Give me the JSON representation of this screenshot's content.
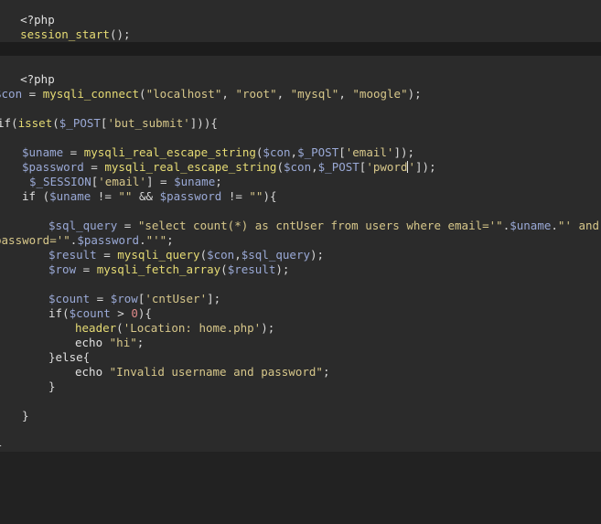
{
  "top_block": {
    "line1": "<?php",
    "line2_fn": "session_start",
    "line2_rest": "();",
    "line3": "?>"
  },
  "main_block": {
    "open_tag": "<?php",
    "con": {
      "var": "$con",
      "eq": " = ",
      "fn": "mysqli_connect",
      "p1": "(",
      "a1": "\"localhost\"",
      "c1": ", ",
      "a2": "\"root\"",
      "c2": ", ",
      "a3": "\"mysql\"",
      "c3": ", ",
      "a4": "\"moogle\"",
      "end": ");"
    },
    "if_isset": {
      "kw": "if",
      "p1": "(",
      "fn": "isset",
      "p2": "(",
      "var": "$_POST",
      "b1": "[",
      "key": "'but_submit'",
      "end": "])){"
    },
    "uname": {
      "var": "$uname",
      "eq": " = ",
      "fn": "mysqli_real_escape_string",
      "p": "(",
      "a1": "$con",
      "c": ",",
      "a2": "$_POST",
      "b": "[",
      "key": "'email'",
      "end": "]);"
    },
    "password": {
      "var": "$password",
      "eq": " = ",
      "fn": "mysqli_real_escape_string",
      "p": "(",
      "a1": "$con",
      "c": ",",
      "a2": "$_POST",
      "b": "[",
      "key_a": "'pword",
      "key_b": "'",
      "end": "]);"
    },
    "session": {
      "var": "$_SESSION",
      "b": "[",
      "key": "'email'",
      "mid": "] = ",
      "val": "$uname",
      "end": ";"
    },
    "if_check": {
      "kw": "if",
      "p": " (",
      "v1": "$uname",
      "op1": " != ",
      "s1": "\"\"",
      "and": " && ",
      "v2": "$password",
      "op2": " != ",
      "s2": "\"\"",
      "end": "){"
    },
    "sql_query": {
      "var": "$sql_query",
      "eq": " = ",
      "s1": "\"select count(*) as cntUser from users where email='\"",
      "dot1": ".",
      "v1": "$uname",
      "dot2": ".",
      "s2": "\"' and"
    },
    "sql_query_cont": {
      "s1": "password='\"",
      "dot1": ".",
      "v1": "$password",
      "dot2": ".",
      "s2": "\"'\"",
      "end": ";"
    },
    "result": {
      "var": "$result",
      "eq": " = ",
      "fn": "mysqli_query",
      "p": "(",
      "a1": "$con",
      "c": ",",
      "a2": "$sql_query",
      "end": ");"
    },
    "row": {
      "var": "$row",
      "eq": " = ",
      "fn": "mysqli_fetch_array",
      "p": "(",
      "a1": "$result",
      "end": ");"
    },
    "count": {
      "var": "$count",
      "eq": " = ",
      "v2": "$row",
      "b": "[",
      "key": "'cntUser'",
      "end": "];"
    },
    "if_count": {
      "kw": "if",
      "p": "(",
      "var": "$count",
      "op": " > ",
      "num": "0",
      "end": "){"
    },
    "header": {
      "fn": "header",
      "p": "(",
      "s": "'Location: home.php'",
      "end": ");"
    },
    "echo_hi": {
      "kw": "echo",
      "sp": " ",
      "s": "\"hi\"",
      "end": ";"
    },
    "else": {
      "b": "}",
      "kw": "else",
      "end": "{"
    },
    "echo_invalid": {
      "kw": "echo",
      "sp": " ",
      "s": "\"Invalid username and password\"",
      "end": ";"
    },
    "close_inner": "}",
    "close_if": "}",
    "close_outer": "}"
  },
  "colors": {
    "background": "#242424",
    "code_bg": "#2b2b2b",
    "function": "#e6db74",
    "variable": "#9aa9d6",
    "string": "#d7c78a",
    "number": "#e08a8a"
  }
}
